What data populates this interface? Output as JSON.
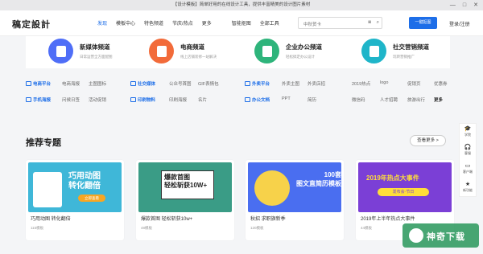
{
  "window": {
    "title": "【设计模板】简单好用的在线设计工具，提供丰富精美的设计图片素材",
    "controls": [
      "—",
      "□",
      "✕"
    ]
  },
  "header": {
    "logo": "稿定設計",
    "nav": [
      "发现",
      "模板中心",
      "特色频道",
      "节庆/热点",
      "更多",
      "智能抠图",
      "全部工具"
    ],
    "search_placeholder": "中秋贺卡",
    "cta": "一键抠图",
    "login": "登录/注册"
  },
  "channels": [
    {
      "title": "新媒体频道",
      "subtitle": "日常运营全方面配图",
      "color": "#4f6ef7"
    },
    {
      "title": "电商频道",
      "subtitle": "线上店铺装修一站解决",
      "color": "#f26b3a"
    },
    {
      "title": "企业办公频道",
      "subtitle": "轻松搞定办公设计",
      "color": "#2eb47b"
    },
    {
      "title": "社交营销频道",
      "subtitle": "玩转营销推广",
      "color": "#1fb5c9"
    }
  ],
  "categories": {
    "row1": [
      {
        "label": "电商平台",
        "lead": true
      },
      {
        "label": "电商海报"
      },
      {
        "label": "主图图标"
      },
      {
        "label": "社交媒体",
        "lead": true
      },
      {
        "label": "公众号首图"
      },
      {
        "label": "GIF表情包"
      },
      {
        "label": "外卖平台",
        "lead": true
      },
      {
        "label": "外卖主图"
      },
      {
        "label": "外卖店招"
      },
      {
        "label": "2019热点"
      },
      {
        "label": "logo"
      },
      {
        "label": "促销页"
      },
      {
        "label": "优惠券"
      }
    ],
    "row2": [
      {
        "label": "手机海报",
        "lead": true
      },
      {
        "label": "问候日签"
      },
      {
        "label": "活动促销"
      },
      {
        "label": "印刷物料",
        "lead": true
      },
      {
        "label": "印刷海报"
      },
      {
        "label": "名片"
      },
      {
        "label": "办公文档",
        "lead": true
      },
      {
        "label": "PPT"
      },
      {
        "label": "简历"
      },
      {
        "label": "微信码"
      },
      {
        "label": "人才招聘"
      },
      {
        "label": "旅游出行"
      },
      {
        "label": "更多",
        "bold": true
      }
    ]
  },
  "topics": {
    "title": "推荐专题",
    "more": "查看更多 >",
    "cards": [
      {
        "title": "巧用动图 转化翻倍",
        "count": "115模板",
        "thumb_text": "巧用动图\n转化翻倍",
        "thumb_tag": "立即查看",
        "bg": "#3fb7d8"
      },
      {
        "title": "爆款首图 轻松斩获10w+",
        "count": "48模板",
        "thumb_text": "爆款首图\n轻松斩获10W+",
        "thumb_tag": "",
        "bg": "#3a9c86"
      },
      {
        "title": "秋招 求职旗新季",
        "count": "120模板",
        "thumb_text": "100套\n图文直简历模板",
        "thumb_tag": "",
        "bg": "#4a6ef0"
      },
      {
        "title": "2019年上半年热点大事件",
        "count": "44模板",
        "thumb_text": "2019年热点大事件",
        "thumb_tag": "发布会·节日",
        "bg": "#7b3fd6"
      }
    ]
  },
  "side_tools": [
    {
      "label": "学院",
      "icon": "🎓"
    },
    {
      "label": "客服",
      "icon": "🎧"
    },
    {
      "label": "客户端",
      "icon": "▭"
    },
    {
      "label": "新功能",
      "icon": "★"
    }
  ],
  "watermark": {
    "text": "神奇下载"
  }
}
